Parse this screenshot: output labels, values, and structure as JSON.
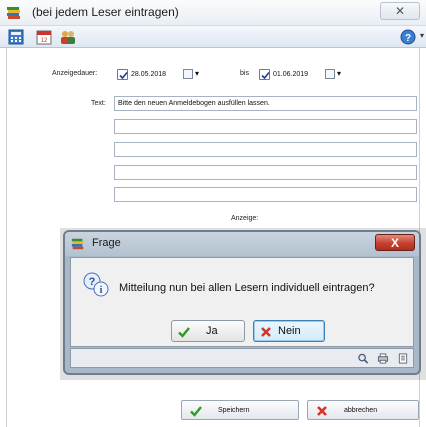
{
  "window": {
    "title": "(bei jedem Leser eintragen)",
    "close_glyph": "✕"
  },
  "toolbar": {
    "buttons": [
      "calculator-icon",
      "calendar-icon",
      "users-icon"
    ],
    "help_icon": "help-icon"
  },
  "form": {
    "anzeigedauer_label": "Anzeigedauer:",
    "from_checked": true,
    "from_date": "28.05.2018",
    "bis_label": "bis",
    "to_checked": true,
    "to_date": "01.06.2019",
    "text_label": "Text:",
    "text_lines": [
      "Bitte den neuen Anmeldebogen ausfüllen lassen.",
      "",
      "",
      "",
      ""
    ],
    "anzeige_label": "Anzeige:",
    "save_label": "Speichern",
    "cancel_label": "abbrechen"
  },
  "dialog": {
    "title": "Frage",
    "message": "Mitteilung nun bei allen Lesern individuell eintragen?",
    "yes_label": "Ja",
    "no_label": "Nein",
    "close_glyph": "X",
    "status_icons": [
      "search-icon",
      "printer-icon",
      "page-icon"
    ]
  },
  "colors": {
    "accent": "#3c7fb1",
    "dialog_frame": "#a9b8c8",
    "close_red": "#c54130",
    "check_green": "#2e9a2a",
    "cancel_red": "#d6342a"
  }
}
